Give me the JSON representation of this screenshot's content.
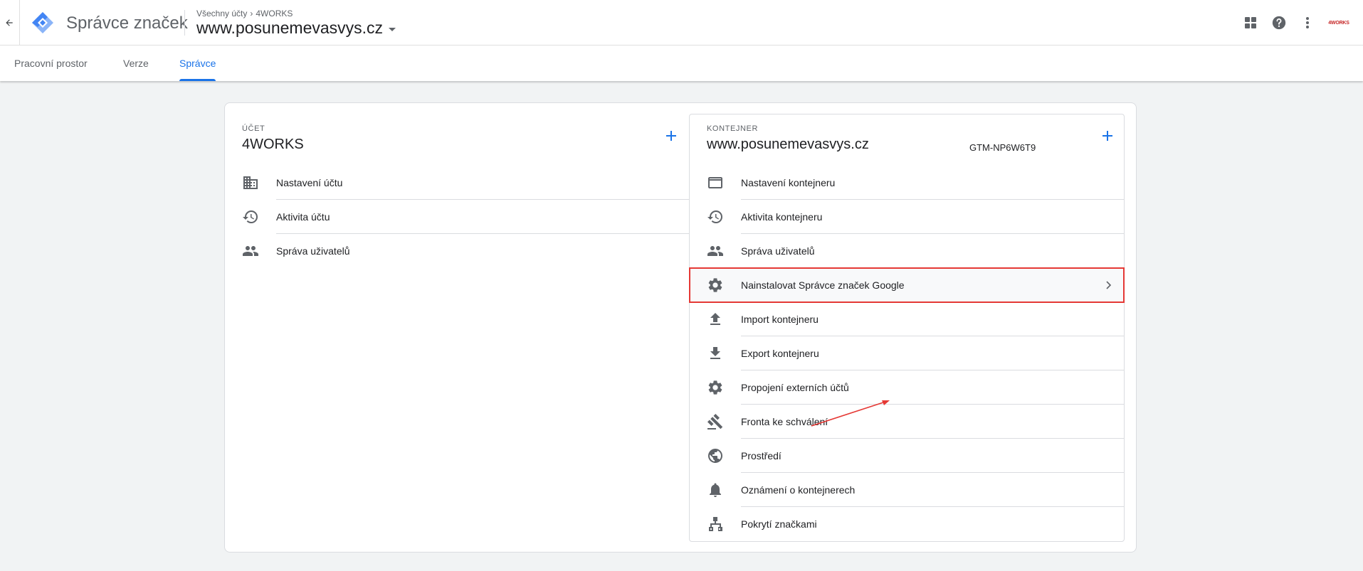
{
  "header": {
    "product_name": "Správce značek",
    "breadcrumb": {
      "all_accounts": "Všechny účty",
      "account": "4WORKS"
    },
    "container_name": "www.posunemevasvys.cz",
    "account_logo_text": "4WORKS"
  },
  "tabs": [
    {
      "label": "Pracovní prostor"
    },
    {
      "label": "Verze"
    },
    {
      "label": "Správce"
    }
  ],
  "account_column": {
    "label": "Účet",
    "title": "4WORKS",
    "items": [
      {
        "label": "Nastavení účtu",
        "icon": "building-icon"
      },
      {
        "label": "Aktivita účtu",
        "icon": "history-icon"
      },
      {
        "label": "Správa uživatelů",
        "icon": "people-icon"
      }
    ]
  },
  "container_column": {
    "label": "Kontejner",
    "title": "www.posunemevasvys.cz",
    "container_id": "GTM-NP6W6T9",
    "items": [
      {
        "label": "Nastavení kontejneru",
        "icon": "web-icon"
      },
      {
        "label": "Aktivita kontejneru",
        "icon": "history-icon"
      },
      {
        "label": "Správa uživatelů",
        "icon": "people-icon"
      },
      {
        "label": "Nainstalovat Správce značek Google",
        "icon": "gear-icon",
        "highlighted": true
      },
      {
        "label": "Import kontejneru",
        "icon": "upload-icon"
      },
      {
        "label": "Export kontejneru",
        "icon": "download-icon"
      },
      {
        "label": "Propojení externích účtů",
        "icon": "gear-icon"
      },
      {
        "label": "Fronta ke schválení",
        "icon": "gavel-icon"
      },
      {
        "label": "Prostředí",
        "icon": "globe-icon"
      },
      {
        "label": "Oznámení o kontejnerech",
        "icon": "bell-icon"
      },
      {
        "label": "Pokrytí značkami",
        "icon": "hierarchy-icon"
      }
    ]
  },
  "colors": {
    "accent": "#1a73e8",
    "highlight_border": "#e53935",
    "background": "#f1f3f4"
  }
}
